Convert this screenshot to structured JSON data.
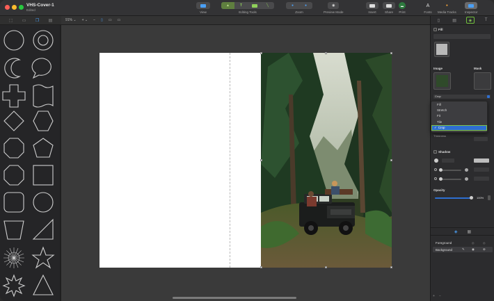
{
  "window": {
    "title": "VHS-Cover-1",
    "subtitle": "Edited",
    "colors": {
      "close": "#ff5f57",
      "minimize": "#febc2e",
      "zoom": "#28c840",
      "accent": "#2e6fd1",
      "highlight": "#7fc44a"
    }
  },
  "toolbar": {
    "view_label": "View",
    "editing_tools_label": "Editing Tools",
    "zoom_label": "Zoom",
    "preview_label": "Preview Mode",
    "insert_label": "Insert",
    "share_label": "Share",
    "print_label": "Print",
    "fonts_label": "Fonts",
    "media_tracks_label": "Media Tracks",
    "inspector_label": "Inspector"
  },
  "canvas_bar": {
    "zoom_value": "91%",
    "zoom_menu_icon": "chevron-down-icon",
    "add_icon": "plus-icon",
    "remove_icon": "minus-icon"
  },
  "inspector": {
    "fill_label": "Fill",
    "image_label": "Image",
    "mask_label": "Mask",
    "scale_mode_value": "Crop",
    "scale_mode_options": [
      "Fill",
      "Stretch",
      "Fit",
      "Tile",
      "Crop"
    ],
    "thickness_label": "Thickness",
    "shadow_label": "Shadow",
    "opacity_label": "Opacity",
    "opacity_value": "100%",
    "opacity_level": 1.0
  },
  "layers": [
    {
      "name": "Foreground"
    },
    {
      "name": "Background"
    }
  ]
}
